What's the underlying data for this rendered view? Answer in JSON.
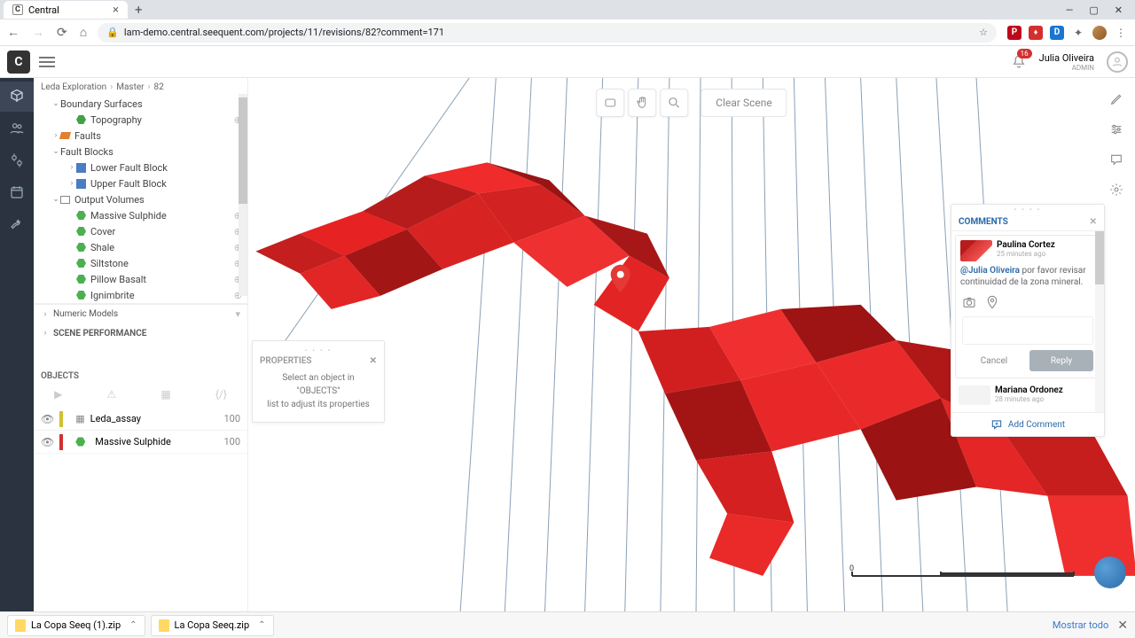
{
  "browser": {
    "tab_title": "Central",
    "url": "lam-demo.central.seequent.com/projects/11/revisions/82?comment=171",
    "window_controls": {
      "min": "—",
      "max": "▢",
      "close": "✕"
    }
  },
  "header": {
    "notifications_count": "16",
    "user_name": "Julia Oliveira",
    "user_role": "ADMIN"
  },
  "breadcrumb": [
    "Leda Exploration",
    "›",
    "Master",
    "›",
    "82"
  ],
  "tree_groups": [
    {
      "label": "Boundary Surfaces",
      "expand": "⌄",
      "indent": 20,
      "children": [
        {
          "label": "Topography",
          "icon": "hex",
          "color": "#43a047",
          "plus": true,
          "indent": 38
        }
      ]
    },
    {
      "label": "Faults",
      "expand": "›",
      "indent": 20,
      "iconcolor": "#e08030"
    },
    {
      "label": "Fault Blocks",
      "expand": "⌄",
      "indent": 20,
      "children": [
        {
          "label": "Lower Fault Block",
          "expand": "›",
          "icon": "cube",
          "color": "#4b7cc4",
          "indent": 38
        },
        {
          "label": "Upper Fault Block",
          "expand": "›",
          "icon": "cube",
          "color": "#4b7cc4",
          "indent": 38
        }
      ]
    },
    {
      "label": "Output Volumes",
      "expand": "⌄",
      "indent": 20,
      "iconbox": true,
      "children": [
        {
          "label": "Massive Sulphide",
          "icon": "hex",
          "color": "#4caf50",
          "plus": true,
          "indent": 38
        },
        {
          "label": "Cover",
          "icon": "hex",
          "color": "#4caf50",
          "plus": true,
          "indent": 38
        },
        {
          "label": "Shale",
          "icon": "hex",
          "color": "#4caf50",
          "plus": true,
          "indent": 38
        },
        {
          "label": "Siltstone",
          "icon": "hex",
          "color": "#4caf50",
          "plus": true,
          "indent": 38
        },
        {
          "label": "Pillow Basalt",
          "icon": "hex",
          "color": "#4caf50",
          "plus": true,
          "indent": 38
        },
        {
          "label": "Ignimbrite",
          "icon": "hex",
          "color": "#4caf50",
          "plus": true,
          "indent": 38
        }
      ]
    }
  ],
  "numeric_models": "Numeric Models",
  "scene_perf": "SCENE PERFORMANCE",
  "objects": {
    "title": "OBJECTS",
    "rows": [
      {
        "name": "Leda_assay",
        "opacity": "100",
        "swatch": "#d0c030",
        "type": "table"
      },
      {
        "name": "Massive Sulphide",
        "opacity": "100",
        "swatch": "#d32f2f",
        "type": "hex"
      }
    ]
  },
  "properties": {
    "title": "PROPERTIES",
    "body1": "Select an object in \"OBJECTS\"",
    "body2": "list to adjust its properties"
  },
  "toolbar": {
    "clear": "Clear Scene"
  },
  "scalebar": {
    "zero": "0"
  },
  "comments": {
    "title": "COMMENTS",
    "items": [
      {
        "author": "Paulina Cortez",
        "time": "25 minutes ago",
        "mention": "@Julia Oliveira",
        "text": " por favor revisar continuidad de la zona mineral."
      },
      {
        "author": "Mariana Ordonez",
        "time": "28 minutes ago"
      }
    ],
    "cancel": "Cancel",
    "reply": "Reply",
    "add": "Add Comment"
  },
  "downloads": {
    "items": [
      "La Copa Seeq (1).zip",
      "La Copa Seeq.zip"
    ],
    "show_all": "Mostrar todo"
  }
}
